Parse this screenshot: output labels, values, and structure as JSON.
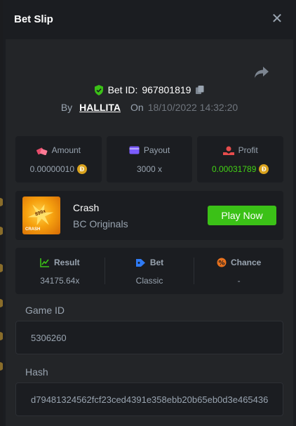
{
  "header": {
    "title": "Bet Slip",
    "close_icon": "close-icon"
  },
  "bet": {
    "id_label": "Bet ID:",
    "id_value": "967801819",
    "by_label": "By",
    "user": "HALLITA",
    "on_label": "On",
    "date": "18/10/2022 14:32:20"
  },
  "stats": {
    "amount": {
      "label": "Amount",
      "value": "0.00000010",
      "icon": "coins-icon"
    },
    "payout": {
      "label": "Payout",
      "value": "3000 x",
      "icon": "wallet-icon"
    },
    "profit": {
      "label": "Profit",
      "value": "0.00031789",
      "icon": "profit-icon"
    }
  },
  "coin_symbol": "Đ",
  "game": {
    "name": "Crash",
    "provider": "BC Originals",
    "play_label": "Play Now",
    "thumb_multiplier": "899x",
    "thumb_label": "CRASH"
  },
  "info": {
    "result": {
      "label": "Result",
      "value": "34175.64x"
    },
    "bet": {
      "label": "Bet",
      "value": "Classic"
    },
    "chance": {
      "label": "Chance",
      "value": "-"
    }
  },
  "fields": {
    "game_id_label": "Game ID",
    "game_id_value": "5306260",
    "hash_label": "Hash",
    "hash_value": "d79481324562fcf23ced4391e358ebb20b65eb0d3e465436"
  },
  "colors": {
    "accent_green": "#3bc117",
    "profit_green": "#43d315",
    "panel": "#1b1d21",
    "content": "#232528"
  }
}
